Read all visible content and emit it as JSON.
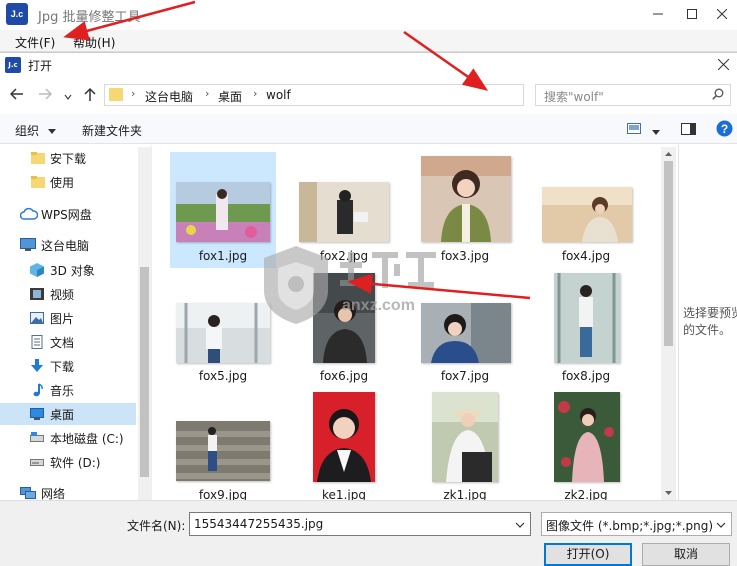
{
  "app": {
    "logo_text": "J.c",
    "title": "Jpg 批量修整工具",
    "menu": {
      "file": "文件(F)",
      "help": "帮助(H)"
    }
  },
  "dialog": {
    "title": "打开",
    "address": {
      "crumbs": [
        "这台电脑",
        "桌面",
        "wolf"
      ]
    },
    "search_placeholder": "搜索\"wolf\"",
    "toolbar": {
      "organize": "组织",
      "new_folder": "新建文件夹"
    },
    "sidebar": [
      {
        "label": "安下载",
        "icon": "folder-icon"
      },
      {
        "label": "使用",
        "icon": "folder-icon"
      },
      {
        "label": "WPS网盘",
        "icon": "cloud-icon"
      },
      {
        "label": "这台电脑",
        "icon": "computer-icon"
      },
      {
        "label": "3D 对象",
        "icon": "3d-objects-icon"
      },
      {
        "label": "视频",
        "icon": "video-icon"
      },
      {
        "label": "图片",
        "icon": "pictures-icon"
      },
      {
        "label": "文档",
        "icon": "documents-icon"
      },
      {
        "label": "下载",
        "icon": "download-icon"
      },
      {
        "label": "音乐",
        "icon": "music-icon"
      },
      {
        "label": "桌面",
        "icon": "desktop-icon",
        "selected": true
      },
      {
        "label": "本地磁盘 (C:)",
        "icon": "drive-icon"
      },
      {
        "label": "软件 (D:)",
        "icon": "drive-icon"
      },
      {
        "label": "网络",
        "icon": "network-icon"
      }
    ],
    "files": [
      {
        "name": "fox1.jpg",
        "selected": true
      },
      {
        "name": "fox2.jpg"
      },
      {
        "name": "fox3.jpg"
      },
      {
        "name": "fox4.jpg"
      },
      {
        "name": "fox5.jpg"
      },
      {
        "name": "fox6.jpg"
      },
      {
        "name": "fox7.jpg"
      },
      {
        "name": "fox8.jpg"
      },
      {
        "name": "fox9.jpg"
      },
      {
        "name": "ke1.jpg"
      },
      {
        "name": "zk1.jpg"
      },
      {
        "name": "zk2.jpg"
      }
    ],
    "preview_text": "选择要预览的文件。",
    "filename_label": "文件名(N):",
    "filename_value": "15543447255435.jpg",
    "filetype_value": "图像文件 (*.bmp;*.jpg;*.png)",
    "open_button": "打开(O)",
    "cancel_button": "取消"
  },
  "colors": {
    "accent": "#0078d7",
    "selection": "#cce8ff",
    "arrow": "#e02020"
  }
}
